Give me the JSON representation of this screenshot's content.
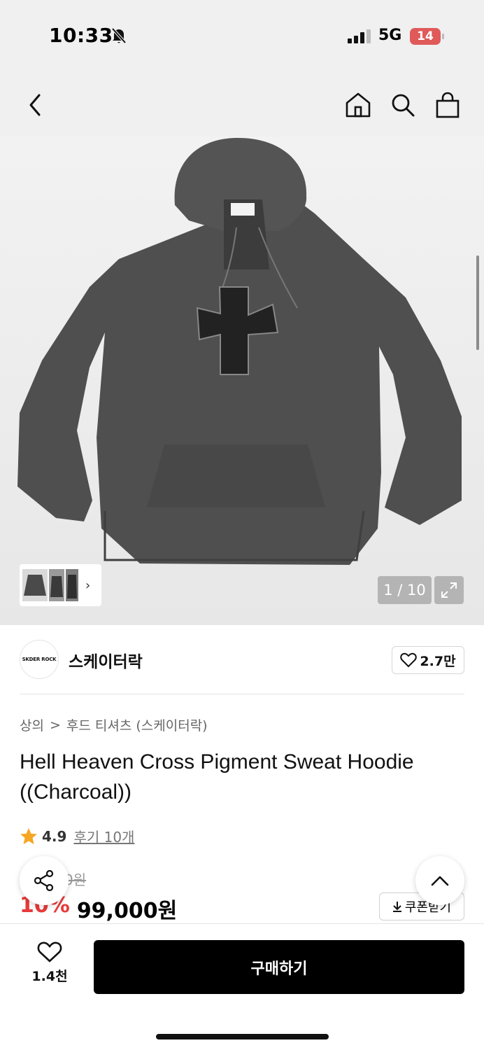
{
  "status": {
    "time": "10:33",
    "network": "5G",
    "battery": "14"
  },
  "gallery": {
    "counter": "1 / 10",
    "thumb_label": "SKDER ROCK"
  },
  "brand": {
    "logo_text": "SKDER ROCK",
    "name": "스케이터락",
    "likes": "2.7만"
  },
  "breadcrumb": {
    "category": "상의",
    "separator": ">",
    "subcategory": "후드 티셔츠 (스케이터락)"
  },
  "product": {
    "title": "Hell Heaven Cross Pigment Sweat Hoodie ((Charcoal))",
    "rating": "4.9",
    "reviews": "후기 10개",
    "original_price": "0원",
    "discount": "10%",
    "price": "99,000원",
    "coupon_label": "쿠폰받기"
  },
  "bottom": {
    "wish_count": "1.4천",
    "buy_label": "구매하기"
  },
  "colors": {
    "accent_red": "#e83a3a",
    "star": "#f5a623",
    "buy_button": "#000000",
    "hoodie": "#505050"
  },
  "icons": [
    "bell-slash-icon",
    "signal-icon",
    "back-icon",
    "home-icon",
    "search-icon",
    "bag-icon",
    "expand-icon",
    "chevron-right-icon",
    "heart-icon",
    "star-icon",
    "share-icon",
    "chevron-up-icon",
    "download-icon"
  ]
}
